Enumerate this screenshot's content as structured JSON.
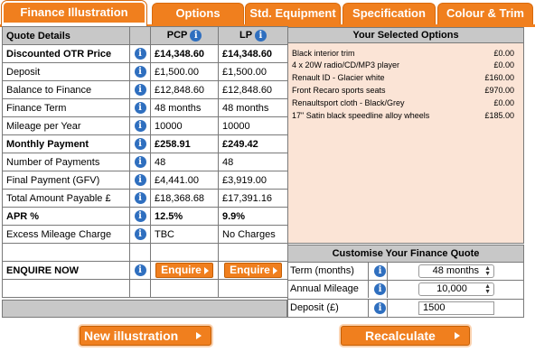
{
  "tabs": [
    {
      "label": "Finance Illustration"
    },
    {
      "label": "Options"
    },
    {
      "label": "Std. Equipment"
    },
    {
      "label": "Specification"
    },
    {
      "label": "Colour & Trim"
    }
  ],
  "quote": {
    "header": {
      "details": "Quote Details",
      "pcp": "PCP",
      "lp": "LP"
    },
    "rows": [
      {
        "label": "Discounted OTR Price",
        "pcp": "£14,348.60",
        "lp": "£14,348.60",
        "bold": true
      },
      {
        "label": "Deposit",
        "pcp": "£1,500.00",
        "lp": "£1,500.00",
        "bold": false
      },
      {
        "label": "Balance to Finance",
        "pcp": "£12,848.60",
        "lp": "£12,848.60",
        "bold": false
      },
      {
        "label": "Finance Term",
        "pcp": "48 months",
        "lp": "48 months",
        "bold": false
      },
      {
        "label": "Mileage per Year",
        "pcp": "10000",
        "lp": "10000",
        "bold": false
      },
      {
        "label": "Monthly Payment",
        "pcp": "£258.91",
        "lp": "£249.42",
        "bold": true
      },
      {
        "label": "Number of Payments",
        "pcp": "48",
        "lp": "48",
        "bold": false
      },
      {
        "label": "Final Payment (GFV)",
        "pcp": "£4,441.00",
        "lp": "£3,919.00",
        "bold": false
      },
      {
        "label": "Total Amount Payable £",
        "pcp": "£18,368.68",
        "lp": "£17,391.16",
        "bold": false
      },
      {
        "label": "APR %",
        "pcp": "12.5%",
        "lp": "9.9%",
        "bold": true
      },
      {
        "label": "Excess Mileage Charge",
        "pcp": "TBC",
        "lp": "No Charges",
        "bold": false
      }
    ],
    "enquire_label": "ENQUIRE NOW",
    "enquire_button": "Enquire",
    "new_illustration": "New illustration"
  },
  "selected_options": {
    "title": "Your Selected Options",
    "items": [
      {
        "name": "Black interior trim",
        "price": "£0.00"
      },
      {
        "name": "4 x 20W radio/CD/MP3 player",
        "price": "£0.00"
      },
      {
        "name": "Renault ID - Glacier white",
        "price": "£160.00"
      },
      {
        "name": "Front Recaro sports seats",
        "price": "£970.00"
      },
      {
        "name": "Renaultsport cloth - Black/Grey",
        "price": "£0.00"
      },
      {
        "name": "17\" Satin black speedline alloy wheels",
        "price": "£185.00"
      }
    ]
  },
  "customise": {
    "title": "Customise Your Finance Quote",
    "term_label": "Term (months)",
    "term_value": "48 months",
    "mileage_label": "Annual Mileage",
    "mileage_value": "10,000",
    "deposit_label": "Deposit (£)",
    "deposit_value": "1500",
    "recalculate": "Recalculate"
  },
  "colors": {
    "accent": "#f07f1e",
    "header_grey": "#c8c8c8",
    "options_bg": "#fbe4d6",
    "info_blue": "#2f6fbf"
  }
}
